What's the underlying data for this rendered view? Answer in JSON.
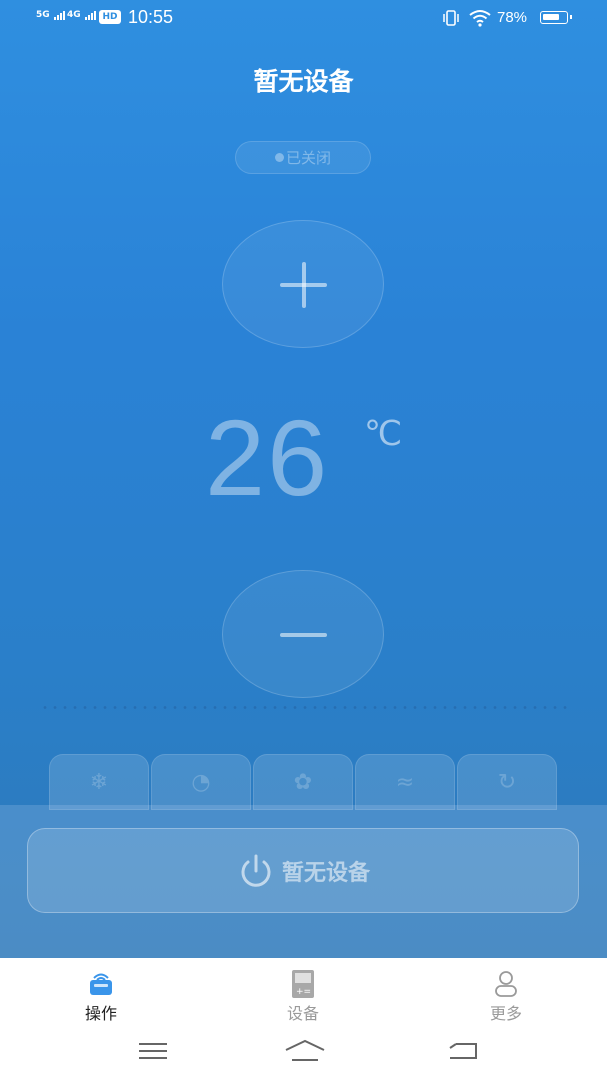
{
  "status_bar": {
    "signal_1": "5G",
    "signal_2": "4G",
    "hd": "HD",
    "time": "10:55",
    "battery": "78%",
    "battery_level": 0.78
  },
  "header": {
    "title": "暂无设备"
  },
  "device_state": {
    "label": "已关闭"
  },
  "temperature": {
    "value": "26",
    "unit": "℃"
  },
  "mode_tabs": [
    {
      "icon": "snowflake-icon"
    },
    {
      "icon": "drop-icon"
    },
    {
      "icon": "fan-icon"
    },
    {
      "icon": "wind-icon"
    },
    {
      "icon": "swing-icon"
    }
  ],
  "power_button": {
    "label": "暂无设备"
  },
  "tabbar": {
    "items": [
      {
        "label": "操作",
        "icon": "remote-icon",
        "active": true
      },
      {
        "label": "设备",
        "icon": "device-icon",
        "active": false
      },
      {
        "label": "更多",
        "icon": "person-icon",
        "active": false
      }
    ]
  },
  "colors": {
    "background": "#2a82d6",
    "active_tab_icon": "#2f8fe0"
  }
}
